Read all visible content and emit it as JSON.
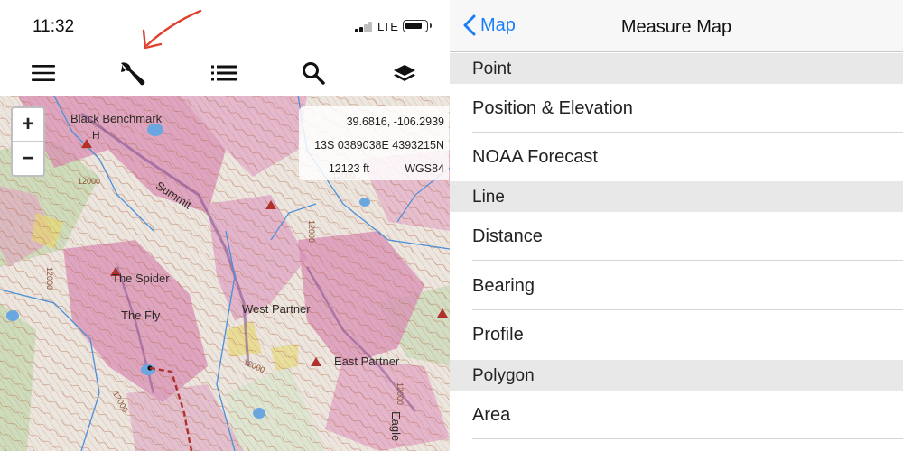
{
  "status_bar": {
    "time": "11:32",
    "network": "LTE",
    "signal_bars": 2,
    "signal_bars_total": 4
  },
  "toolbar": {
    "buttons": [
      "menu-icon",
      "wrench-icon",
      "list-icon",
      "search-icon",
      "layers-icon"
    ]
  },
  "map": {
    "labels": {
      "black_benchmark": "Black Benchmark",
      "black_benchmark_h": "H",
      "summit": "Summit",
      "the_spider": "The Spider",
      "the_fly": "The Fly",
      "west_partner": "West Partner",
      "east_partner": "East Partner",
      "eagle": "Eagle"
    },
    "contour_labels": [
      "12000",
      "12000",
      "12000",
      "12000",
      "12000",
      "12000",
      "12000"
    ],
    "zoom_in": "+",
    "zoom_out": "−",
    "coordinates": {
      "latlon": "39.6816, -106.2939",
      "utm": "13S 0389038E 4393215N",
      "elevation": "12123 ft",
      "datum": "WGS84"
    },
    "colors": {
      "slope_shade": "#d98fb3",
      "contour": "#b4643c",
      "water": "#4a90d9",
      "trail": "#b0302a"
    }
  },
  "measure": {
    "back_label": "Map",
    "title": "Measure Map",
    "sections": [
      {
        "header": "Point",
        "items": [
          "Position & Elevation",
          "NOAA Forecast"
        ]
      },
      {
        "header": "Line",
        "items": [
          "Distance",
          "Bearing",
          "Profile"
        ]
      },
      {
        "header": "Polygon",
        "items": [
          "Area"
        ]
      }
    ],
    "accent": "#1a7ef8"
  }
}
